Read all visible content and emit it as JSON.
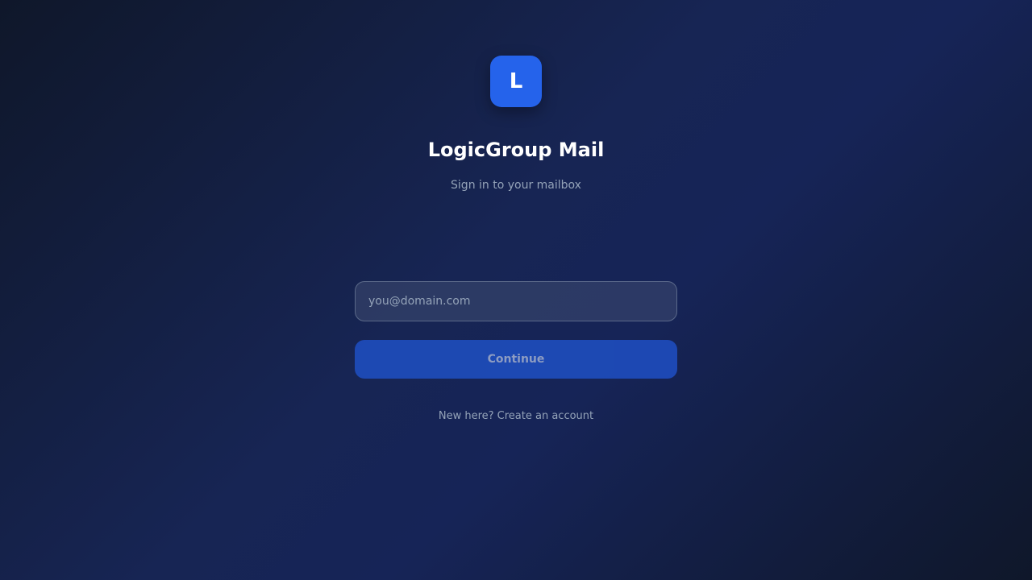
{
  "brand": {
    "logo_letter": "L",
    "logo_color": "#2563eb",
    "name": "LogicGroup Mail"
  },
  "login": {
    "subtitle": "Sign in to your mailbox",
    "email": {
      "value": "",
      "placeholder": "you@domain.com"
    },
    "continue_label": "Continue",
    "signup_text": "New here? Create an account"
  },
  "colors": {
    "background_dark": "#0f172a",
    "background_mid": "#172554",
    "accent": "#2563eb",
    "muted_text": "#94a3b8"
  }
}
